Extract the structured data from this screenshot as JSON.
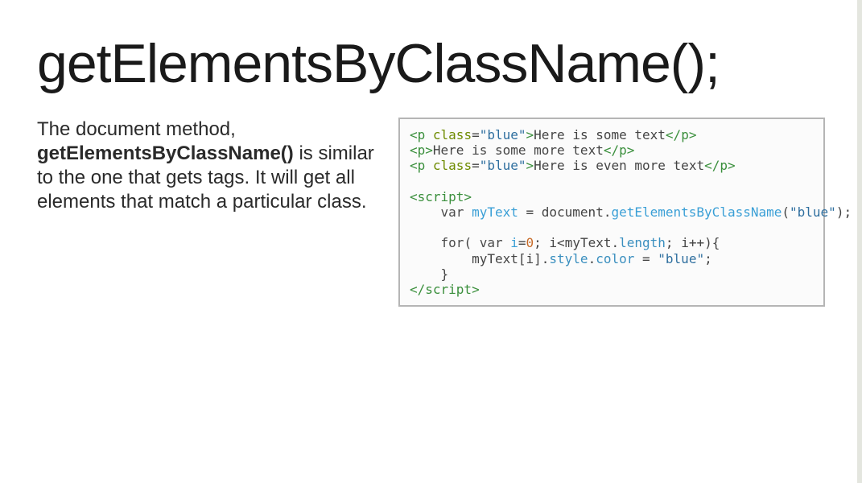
{
  "title": "getElementsByClassName();",
  "description": {
    "lead": "The document method, ",
    "bold": "getElementsByClassName()",
    "rest": " is similar to the one that gets tags. It will get all elements that match a particular class."
  },
  "code": {
    "raw": "<p class=\"blue\">Here is some text</p>\n<p>Here is some more text</p>\n<p class=\"blue\">Here is even more text</p>\n\n<script>\n    var myText = document.getElementsByClassName(\"blue\");\n\n    for( var i=0; i<myText.length; i++){\n        myText[i].style.color = \"blue\";\n    }\n</script>",
    "lines": [
      {
        "segments": [
          {
            "t": "<p ",
            "c": "t-tag"
          },
          {
            "t": "class",
            "c": "t-attrn"
          },
          {
            "t": "=",
            "c": ""
          },
          {
            "t": "\"blue\"",
            "c": "t-attrv"
          },
          {
            "t": ">",
            "c": "t-tag"
          },
          {
            "t": "Here is some text",
            "c": ""
          },
          {
            "t": "</p>",
            "c": "t-tag"
          }
        ]
      },
      {
        "segments": [
          {
            "t": "<p>",
            "c": "t-tag"
          },
          {
            "t": "Here is some more text",
            "c": ""
          },
          {
            "t": "</p>",
            "c": "t-tag"
          }
        ]
      },
      {
        "segments": [
          {
            "t": "<p ",
            "c": "t-tag"
          },
          {
            "t": "class",
            "c": "t-attrn"
          },
          {
            "t": "=",
            "c": ""
          },
          {
            "t": "\"blue\"",
            "c": "t-attrv"
          },
          {
            "t": ">",
            "c": "t-tag"
          },
          {
            "t": "Here is even more text",
            "c": ""
          },
          {
            "t": "</p>",
            "c": "t-tag"
          }
        ]
      },
      {
        "segments": [
          {
            "t": "",
            "c": ""
          }
        ]
      },
      {
        "segments": [
          {
            "t": "<script>",
            "c": "t-tag"
          }
        ]
      },
      {
        "segments": [
          {
            "t": "    ",
            "c": ""
          },
          {
            "t": "var ",
            "c": "t-kw"
          },
          {
            "t": "myText",
            "c": "t-var"
          },
          {
            "t": " = document.",
            "c": ""
          },
          {
            "t": "getElementsByClassName",
            "c": "t-func"
          },
          {
            "t": "(",
            "c": ""
          },
          {
            "t": "\"blue\"",
            "c": "t-str"
          },
          {
            "t": ");",
            "c": ""
          }
        ]
      },
      {
        "segments": [
          {
            "t": "",
            "c": ""
          }
        ]
      },
      {
        "segments": [
          {
            "t": "    ",
            "c": ""
          },
          {
            "t": "for",
            "c": "t-kw"
          },
          {
            "t": "( ",
            "c": ""
          },
          {
            "t": "var ",
            "c": "t-kw"
          },
          {
            "t": "i",
            "c": "t-var"
          },
          {
            "t": "=",
            "c": ""
          },
          {
            "t": "0",
            "c": "t-num"
          },
          {
            "t": "; i<myText.",
            "c": ""
          },
          {
            "t": "length",
            "c": "t-prop"
          },
          {
            "t": "; i++){",
            "c": ""
          }
        ]
      },
      {
        "segments": [
          {
            "t": "        myText[i].",
            "c": ""
          },
          {
            "t": "style",
            "c": "t-prop"
          },
          {
            "t": ".",
            "c": ""
          },
          {
            "t": "color",
            "c": "t-prop"
          },
          {
            "t": " = ",
            "c": ""
          },
          {
            "t": "\"blue\"",
            "c": "t-str"
          },
          {
            "t": ";",
            "c": ""
          }
        ]
      },
      {
        "segments": [
          {
            "t": "    }",
            "c": ""
          }
        ]
      },
      {
        "segments": [
          {
            "t": "</script>",
            "c": "t-tag"
          }
        ]
      }
    ]
  }
}
